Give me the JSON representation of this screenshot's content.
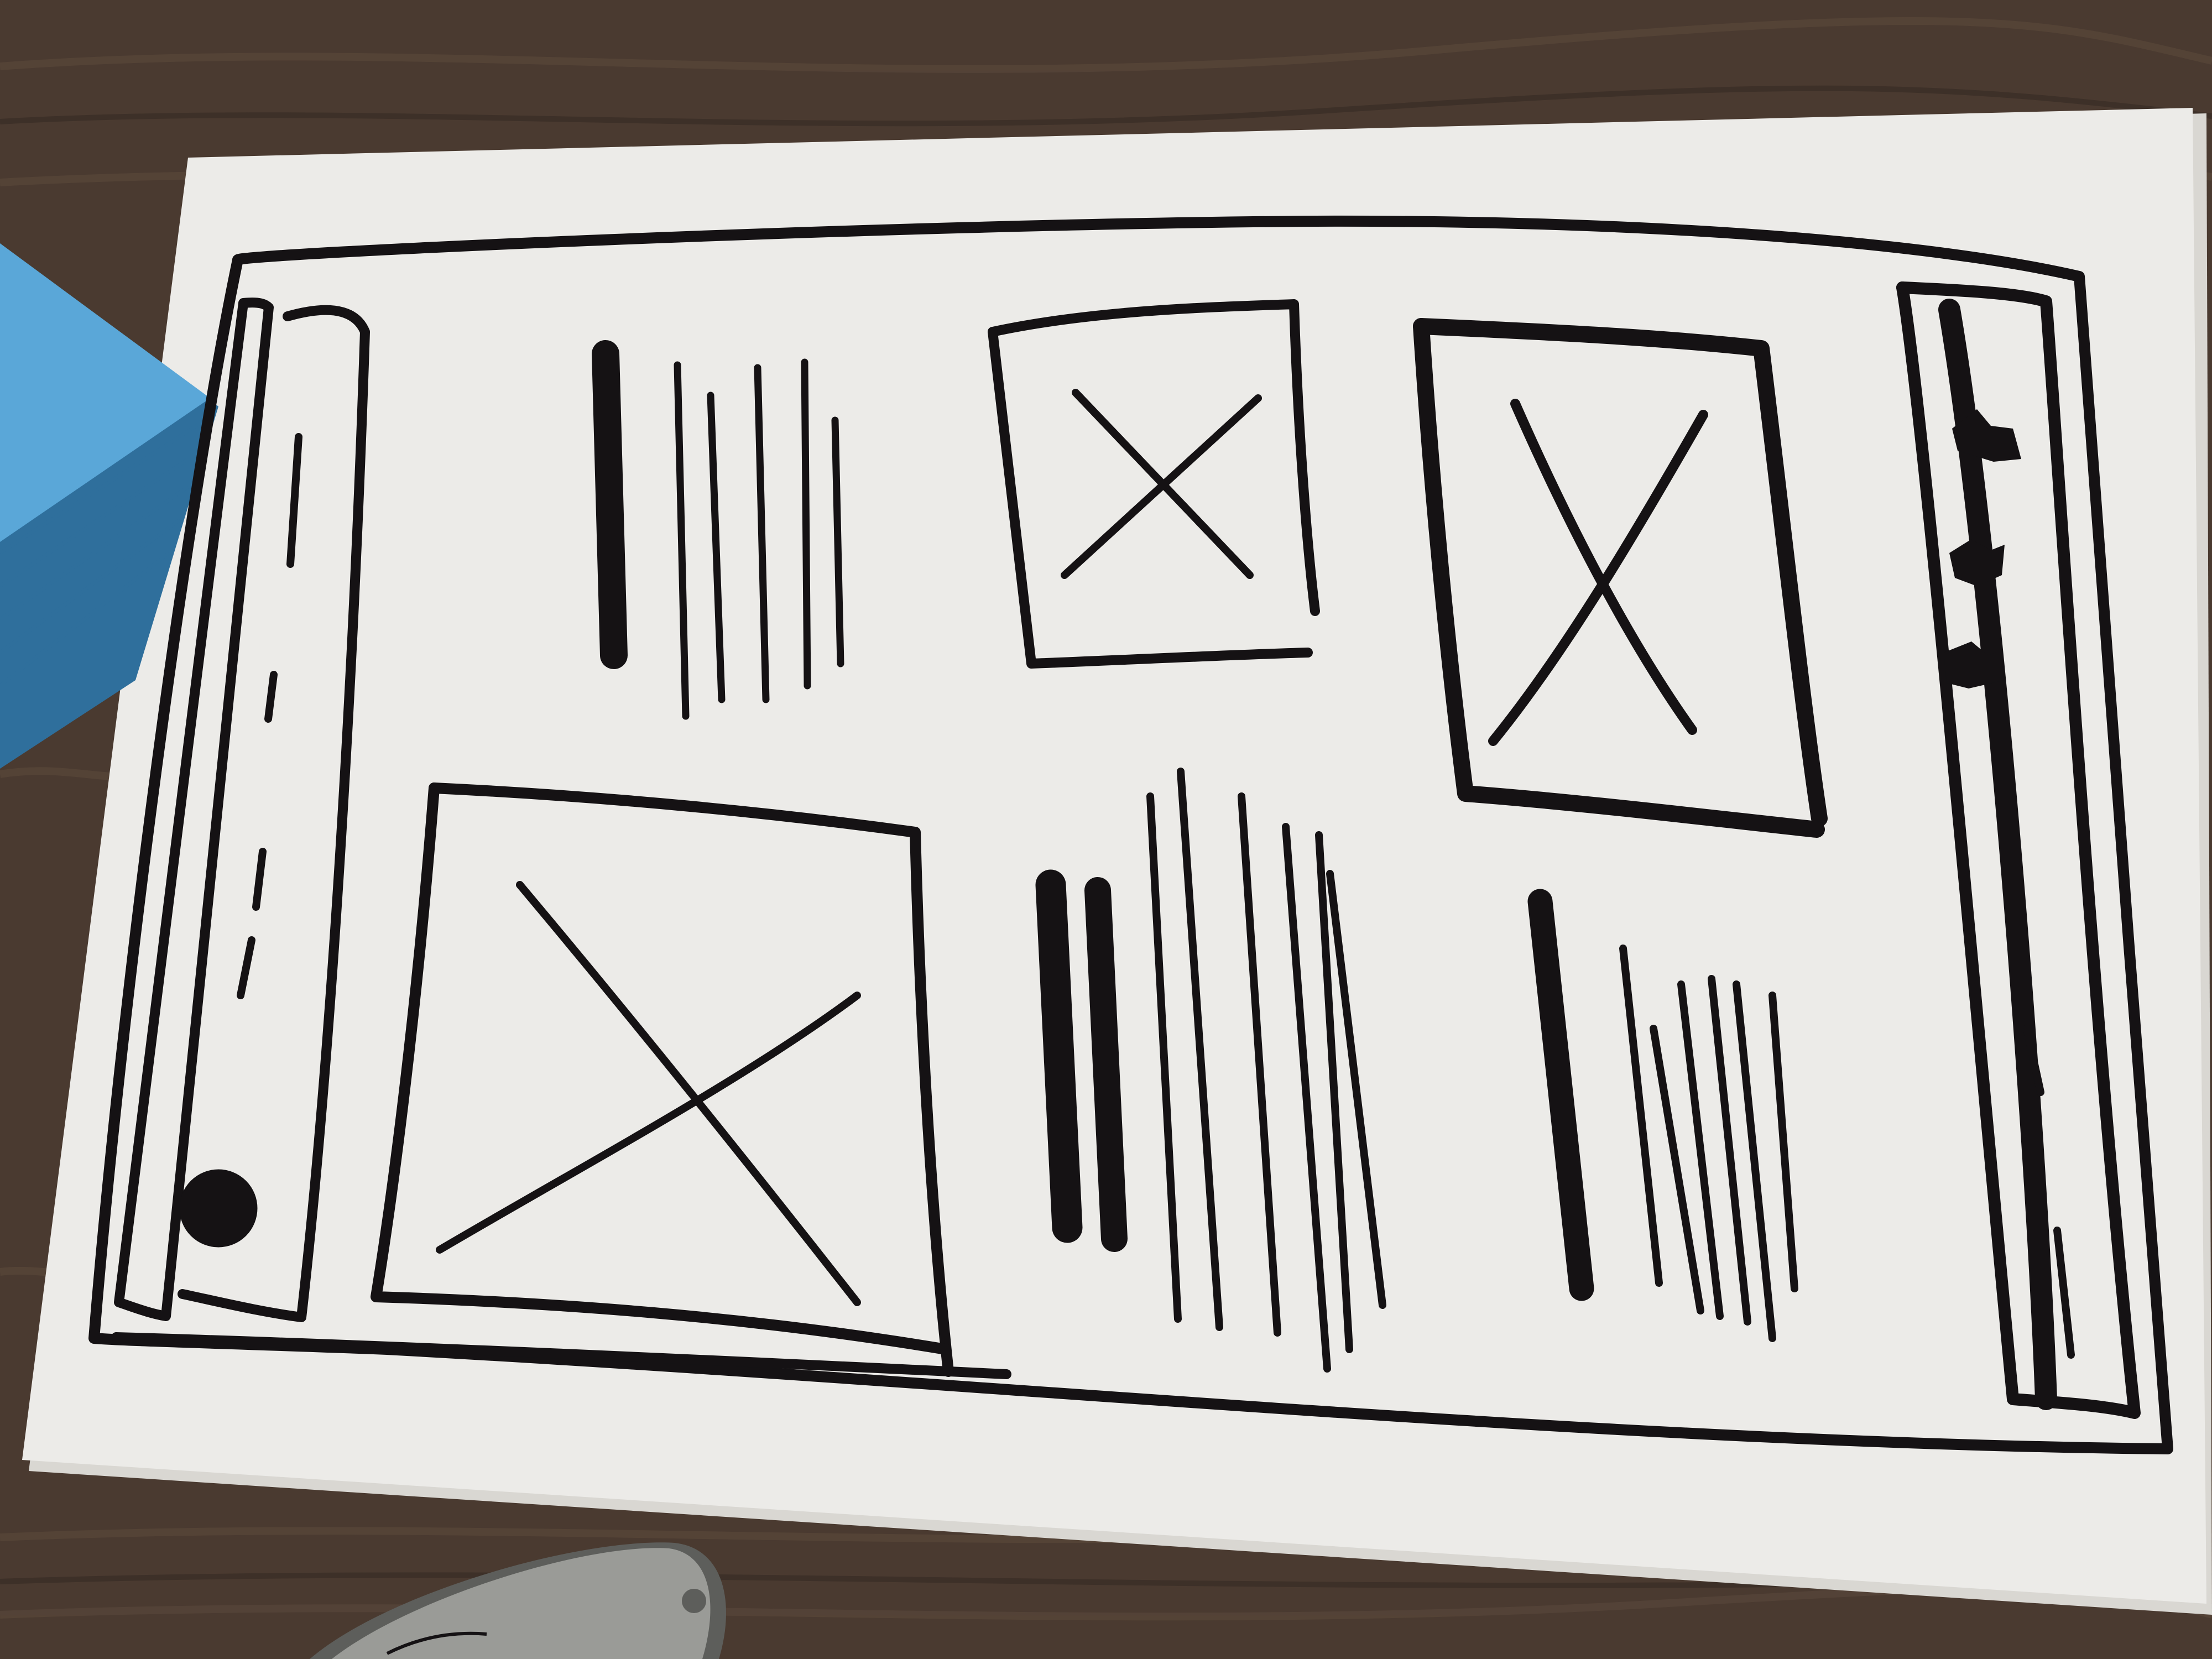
{
  "scene": {
    "colors": {
      "table": "#4a3a30",
      "table_grain": "#5c4a3d",
      "table_dark": "#2f2520",
      "paper": "#ecebe8",
      "paper_shadow": "#d9d7d2",
      "ink": "#151214",
      "sticky_notes": "#5aa7d8",
      "sticky_notes_edge": "#2f6f9c",
      "marker_body": "#9a9b97",
      "marker_shadow": "#5d5e5b"
    },
    "sketch": {
      "left_sidebar_has_avatar": true,
      "right_sidebar_icon_count": 3,
      "image_placeholder_count": 3,
      "text_block_count": 3
    }
  }
}
